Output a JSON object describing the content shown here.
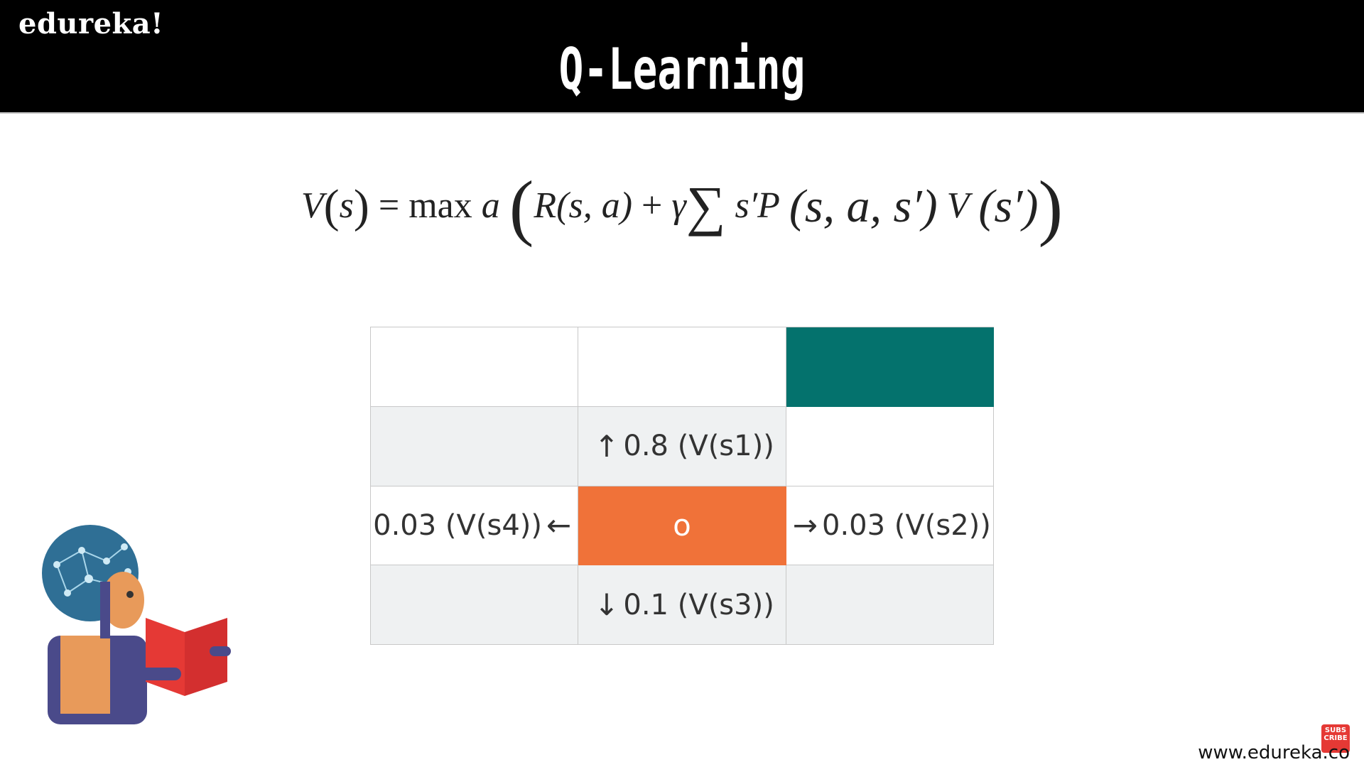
{
  "header": {
    "brand": "edureka!",
    "title": "Q-Learning"
  },
  "formula": {
    "lhs": "V",
    "lhs_paren_open": "(",
    "lhs_arg": "s",
    "lhs_paren_close": ")",
    "equals": "=",
    "max": "max",
    "a": "a",
    "open": "(",
    "reward": "R",
    "reward_args": "(s, a)",
    "plus": "+",
    "gamma": "γ",
    "sum": "∑",
    "s_prime": "s′",
    "prob": "P",
    "prob_args": "(s, a, s′)",
    "value": "V",
    "value_args": "(s′)",
    "close": ")"
  },
  "grid": {
    "agent_label": "o",
    "up": {
      "arrow": "↑",
      "text": "0.8 (V(s1))"
    },
    "right": {
      "arrow": "→",
      "text": "0.03 (V(s2))"
    },
    "down": {
      "arrow": "↓",
      "text": "0.1 (V(s3))"
    },
    "left": {
      "arrow": "←",
      "text": "0.03 (V(s4))"
    }
  },
  "colors": {
    "goal": "#04726d",
    "agent": "#f07239",
    "cell_gray": "#eff1f2"
  },
  "footer": {
    "subscribe_text": "SUBS CRIBE",
    "website": "www.edureka.co"
  }
}
